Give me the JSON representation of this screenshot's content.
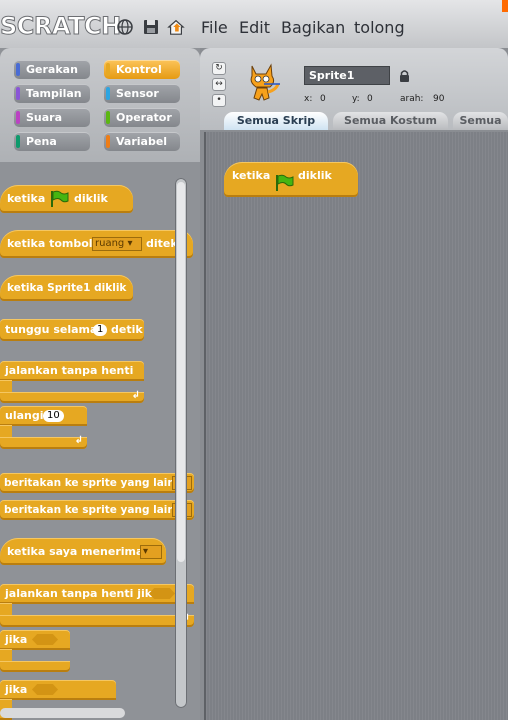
{
  "app": {
    "logo": "SCRATCH"
  },
  "menu": {
    "file": "File",
    "edit": "Edit",
    "share": "Bagikan",
    "help": "tolong"
  },
  "categories": {
    "motion": "Gerakan",
    "control": "Kontrol",
    "looks": "Tampilan",
    "sensing": "Sensor",
    "sound": "Suara",
    "operators": "Operator",
    "pen": "Pena",
    "variables": "Variabel"
  },
  "category_colors": {
    "motion": "#4a6cd4",
    "control": "#e6a822",
    "looks": "#8a55d7",
    "sensing": "#2ca5e2",
    "sound": "#bb42c3",
    "operators": "#5cb712",
    "pen": "#0e9a6c",
    "variables": "#ee7d16"
  },
  "blocks": {
    "when_flag_prefix": "ketika",
    "when_flag_suffix": "diklik",
    "when_key_prefix": "ketika tombol",
    "when_key_value": "ruang",
    "when_key_suffix": "diteka",
    "when_sprite_clicked": "ketika  Sprite1  diklik",
    "wait_prefix": "tunggu selama",
    "wait_value": "1",
    "wait_suffix": "detik",
    "forever": "jalankan tanpa henti",
    "repeat_prefix": "ulangi",
    "repeat_value": "10",
    "broadcast": "beritakan ke sprite yang lain",
    "broadcast_wait": "beritakan ke sprite yang lain",
    "when_receive": "ketika saya menerima",
    "forever_if": "jalankan tanpa henti jika",
    "if1": "jika",
    "if2": "jika"
  },
  "sprite": {
    "name": "Sprite1",
    "x_label": "x:",
    "x_value": "0",
    "y_label": "y:",
    "y_value": "0",
    "direction_label": "arah:",
    "direction_value": "90"
  },
  "tabs": {
    "scripts": "Semua Skrip",
    "costumes": "Semua Kostum",
    "sounds": "Semua"
  },
  "script_area": {
    "block_prefix": "ketika",
    "block_suffix": "diklik"
  }
}
